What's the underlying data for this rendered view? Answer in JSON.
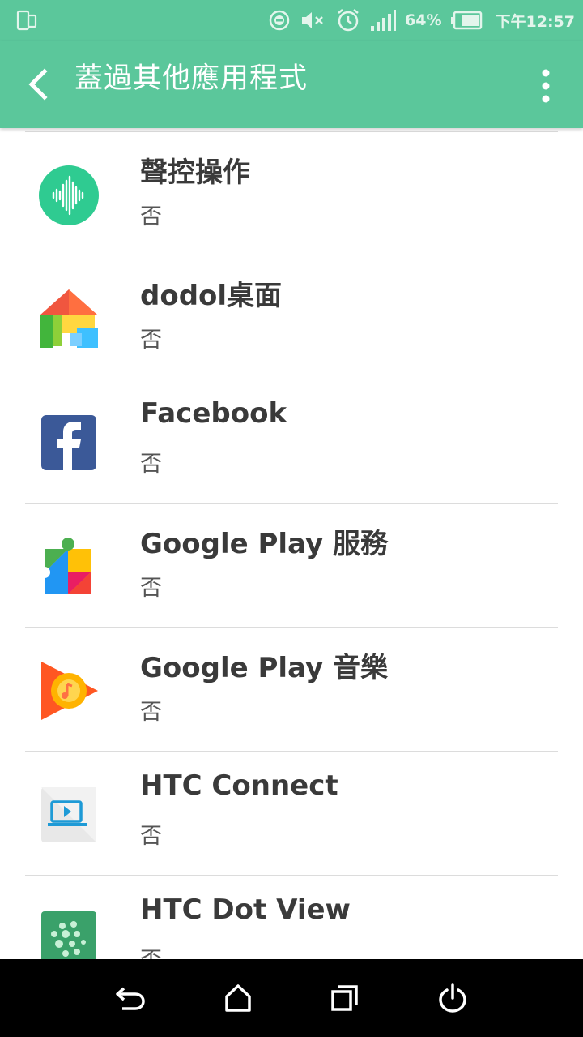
{
  "status_bar": {
    "battery_percent": "64%",
    "time": "下午12:57",
    "icons": [
      "screen-mirror-icon",
      "do-not-disturb-icon",
      "mute-icon",
      "alarm-icon",
      "signal-icon",
      "battery-icon"
    ]
  },
  "app_bar": {
    "title": "蓋過其他應用程式",
    "back_icon": "chevron-left-icon",
    "menu_icon": "more-vert-icon"
  },
  "apps": [
    {
      "name": "聲控操作",
      "status": "否",
      "icon": "voice-control-icon"
    },
    {
      "name": "dodol桌面",
      "status": "否",
      "icon": "dodol-launcher-icon"
    },
    {
      "name": "Facebook",
      "status": "否",
      "icon": "facebook-icon"
    },
    {
      "name": "Google Play 服務",
      "status": "否",
      "icon": "google-play-services-icon"
    },
    {
      "name": "Google Play 音樂",
      "status": "否",
      "icon": "google-play-music-icon"
    },
    {
      "name": "HTC Connect",
      "status": "否",
      "icon": "htc-connect-icon"
    },
    {
      "name": "HTC Dot View",
      "status": "否",
      "icon": "htc-dot-view-icon"
    }
  ],
  "nav_bar": {
    "buttons": [
      "back-icon",
      "home-icon",
      "recents-icon",
      "power-icon"
    ]
  },
  "colors": {
    "accent": "#5bc79b",
    "nav_background": "#000000"
  }
}
